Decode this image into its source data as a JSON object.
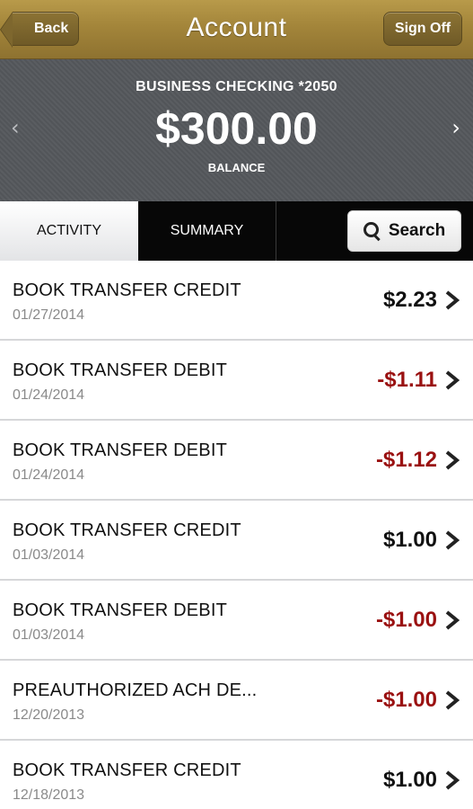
{
  "header": {
    "back_label": "Back",
    "title": "Account",
    "signoff_label": "Sign Off"
  },
  "balance_panel": {
    "account_name": "BUSINESS CHECKING *2050",
    "balance": "$300.00",
    "balance_label": "BALANCE",
    "prev_glyph": "‹",
    "next_glyph": "›"
  },
  "tabs": {
    "activity_label": "ACTIVITY",
    "summary_label": "SUMMARY",
    "search_label": "Search",
    "active_tab": "ACTIVITY"
  },
  "colors": {
    "header_gold": "#a3853a",
    "debit_red": "#9a1111",
    "panel_gray": "#55585c"
  },
  "transactions": [
    {
      "description": "BOOK TRANSFER CREDIT",
      "date": "01/27/2014",
      "amount": "$2.23",
      "type": "credit"
    },
    {
      "description": "BOOK TRANSFER DEBIT",
      "date": "01/24/2014",
      "amount": "-$1.11",
      "type": "debit"
    },
    {
      "description": "BOOK TRANSFER DEBIT",
      "date": "01/24/2014",
      "amount": "-$1.12",
      "type": "debit"
    },
    {
      "description": "BOOK TRANSFER CREDIT",
      "date": "01/03/2014",
      "amount": "$1.00",
      "type": "credit"
    },
    {
      "description": "BOOK TRANSFER DEBIT",
      "date": "01/03/2014",
      "amount": "-$1.00",
      "type": "debit"
    },
    {
      "description": "PREAUTHORIZED ACH DE...",
      "date": "12/20/2013",
      "amount": "-$1.00",
      "type": "debit"
    },
    {
      "description": "BOOK TRANSFER CREDIT",
      "date": "12/18/2013",
      "amount": "$1.00",
      "type": "credit"
    }
  ]
}
